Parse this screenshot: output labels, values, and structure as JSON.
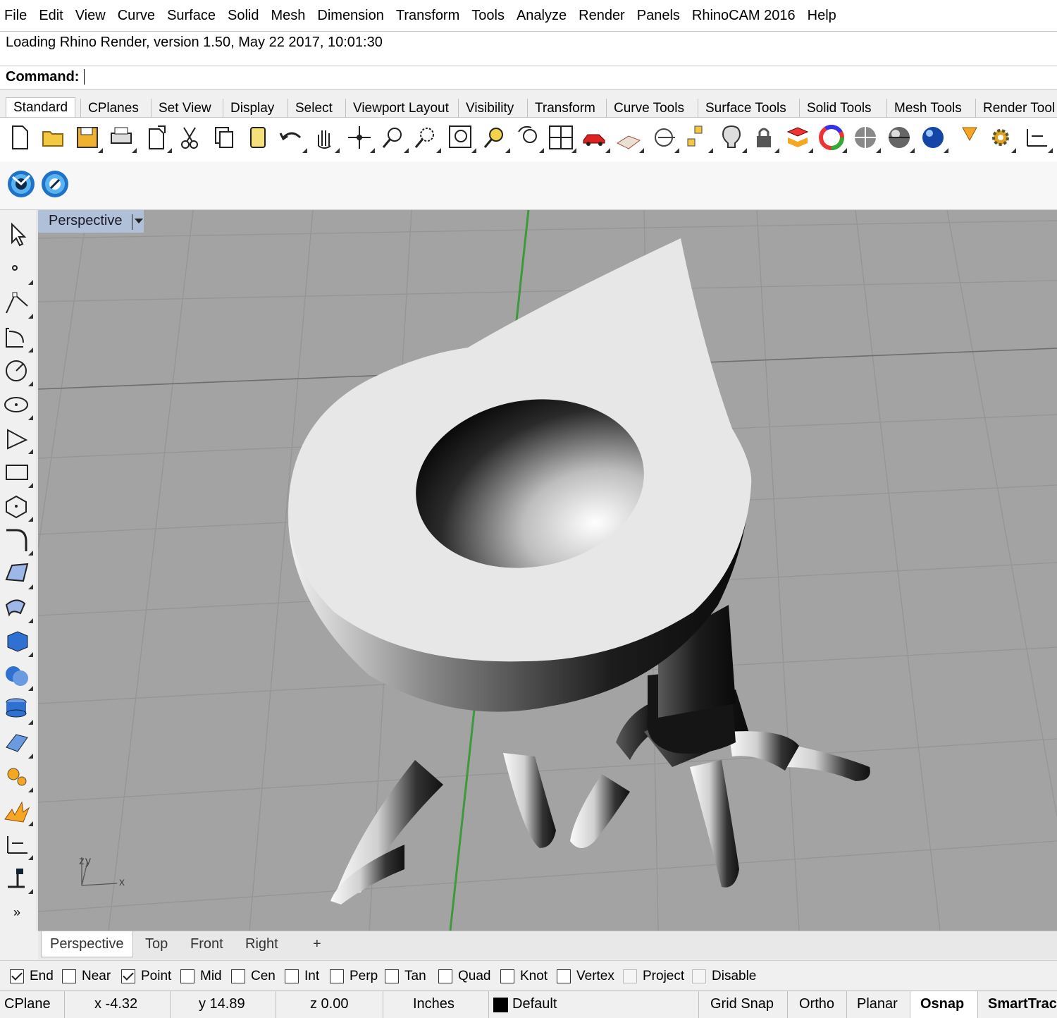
{
  "menu": [
    "File",
    "Edit",
    "View",
    "Curve",
    "Surface",
    "Solid",
    "Mesh",
    "Dimension",
    "Transform",
    "Tools",
    "Analyze",
    "Render",
    "Panels",
    "RhinoCAM 2016",
    "Help"
  ],
  "command": {
    "history": "Loading Rhino Render, version 1.50, May 22 2017, 10:01:30",
    "prompt": "Command:",
    "value": ""
  },
  "toolbar_tabs": [
    "Standard",
    "CPlanes",
    "Set View",
    "Display",
    "Select",
    "Viewport Layout",
    "Visibility",
    "Transform",
    "Curve Tools",
    "Surface Tools",
    "Solid Tools",
    "Mesh Tools",
    "Render Tool"
  ],
  "active_toolbar_tab": "Standard",
  "toolbar_icons": [
    "new-icon",
    "open-icon",
    "save-icon",
    "print-icon",
    "import-icon",
    "cut-icon",
    "copy-icon",
    "paste-icon",
    "undo-icon",
    "pan-icon",
    "rotate-view-icon",
    "zoom-icon",
    "zoom-window-icon",
    "zoom-extents-icon",
    "zoom-selected-icon",
    "undo-view-icon",
    "four-viewports-icon",
    "car-icon",
    "grid-icon",
    "cplane-icon",
    "points-icon",
    "light-icon",
    "lock-icon",
    "layer-icon",
    "color-wheel-icon",
    "shaded-sphere-icon",
    "rendered-sphere-icon",
    "render-sphere-icon",
    "render-tool-icon",
    "settings-gear-icon",
    "dimension-icon"
  ],
  "secondary_toolbar_icons": [
    "rhino-render-icon",
    "rhino-render-settings-icon"
  ],
  "left_toolbar_icons": [
    "select-arrow-icon",
    "point-icon",
    "polyline-icon",
    "curve-icon",
    "circle-icon",
    "ellipse-icon",
    "arc-icon",
    "rectangle-icon",
    "polygon-icon",
    "fillet-icon",
    "surface-icon",
    "extrude-icon",
    "box-icon",
    "boolean-icon",
    "cylinder-icon",
    "plane-icon",
    "transform-icon",
    "explode-icon",
    "dimension-icon",
    "analyze-icon",
    "more-icon"
  ],
  "more_label": "»",
  "viewport": {
    "title": "Perspective",
    "axis_labels": {
      "z": "z",
      "y": "y",
      "x": "x"
    }
  },
  "view_tabs": [
    "Perspective",
    "Top",
    "Front",
    "Right",
    "+"
  ],
  "active_view_tab": "Perspective",
  "osnaps": [
    {
      "label": "End",
      "checked": true,
      "disabled": false
    },
    {
      "label": "Near",
      "checked": false,
      "disabled": false
    },
    {
      "label": "Point",
      "checked": true,
      "disabled": false
    },
    {
      "label": "Mid",
      "checked": false,
      "disabled": false
    },
    {
      "label": "Cen",
      "checked": false,
      "disabled": false
    },
    {
      "label": "Int",
      "checked": false,
      "disabled": false
    },
    {
      "label": "Perp",
      "checked": false,
      "disabled": false
    },
    {
      "label": "Tan",
      "checked": false,
      "disabled": false
    },
    {
      "label": "Quad",
      "checked": false,
      "disabled": false
    },
    {
      "label": "Knot",
      "checked": false,
      "disabled": false
    },
    {
      "label": "Vertex",
      "checked": false,
      "disabled": false
    },
    {
      "label": "Project",
      "checked": false,
      "disabled": true
    },
    {
      "label": "Disable",
      "checked": false,
      "disabled": true
    }
  ],
  "status": {
    "cplane": "CPlane",
    "x": "x -4.32",
    "y": "y 14.89",
    "z": "z 0.00",
    "units": "Inches",
    "layer": "Default",
    "grid_snap": "Grid Snap",
    "ortho": "Ortho",
    "planar": "Planar",
    "osnap": "Osnap",
    "smarttrack": "SmartTrac"
  },
  "colors": {
    "viewport_bg": "#a3a3a3",
    "viewport_title_bg": "#b0c0d8",
    "y_axis_green": "#3c9a3c",
    "grid_line": "#959595"
  }
}
